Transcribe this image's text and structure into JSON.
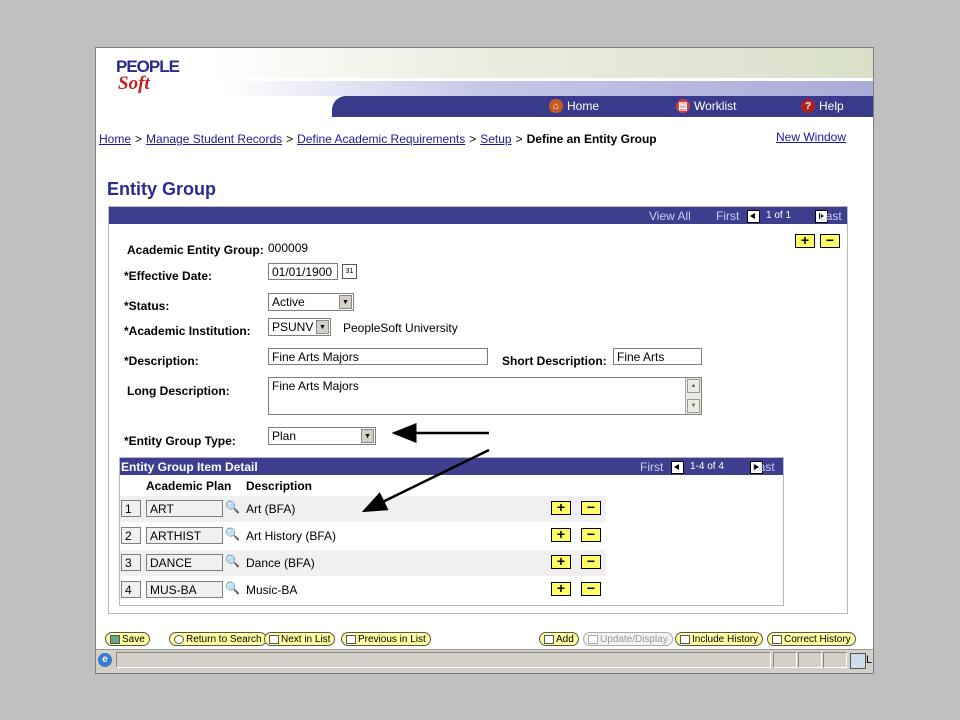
{
  "logo": {
    "line1": "PEOPLE",
    "line2": "Soft"
  },
  "nav": {
    "home": "Home",
    "worklist": "Worklist",
    "help": "Help"
  },
  "breadcrumb": {
    "items": [
      "Home",
      "Manage Student Records",
      "Define Academic Requirements",
      "Setup"
    ],
    "sep": ">",
    "current": "Define an Entity Group"
  },
  "new_window": "New Window",
  "page_title": "Entity Group",
  "panel_bar": {
    "view_all": "View All",
    "first": "First",
    "range": "1 of 1",
    "last": "Last"
  },
  "form": {
    "entity_group_label": "Academic Entity Group:",
    "entity_group_value": "000009",
    "effective_date_label": "*Effective Date:",
    "effective_date_value": "01/01/1900",
    "status_label": "*Status:",
    "status_value": "Active",
    "institution_label": "*Academic Institution:",
    "institution_value": "PSUNV",
    "institution_desc": "PeopleSoft University",
    "description_label": "*Description:",
    "description_value": "Fine Arts Majors",
    "short_desc_label": "Short Description:",
    "short_desc_value": "Fine Arts",
    "long_desc_label": "Long Description:",
    "long_desc_value": "Fine Arts Majors",
    "group_type_label": "*Entity Group Type:",
    "group_type_value": "Plan"
  },
  "detail": {
    "title": "Entity Group Item Detail",
    "first": "First",
    "range": "1-4 of 4",
    "last": "Last",
    "col_plan": "Academic Plan",
    "col_desc": "Description",
    "rows": [
      {
        "num": "1",
        "plan": "ART",
        "desc": "Art (BFA)"
      },
      {
        "num": "2",
        "plan": "ARTHIST",
        "desc": "Art History (BFA)"
      },
      {
        "num": "3",
        "plan": "DANCE",
        "desc": "Dance (BFA)"
      },
      {
        "num": "4",
        "plan": "MUS-BA",
        "desc": "Music-BA"
      }
    ]
  },
  "toolbar": {
    "save": "Save",
    "return": "Return to Search",
    "next": "Next in List",
    "prev": "Previous in List",
    "add": "Add",
    "update": "Update/Display",
    "include": "Include History",
    "correct": "Correct History"
  },
  "status_bar": {
    "zone_text": "L"
  },
  "colors": {
    "nav_bar": "#3a3a8c",
    "title": "#2a2a90",
    "link": "#1a1a9c",
    "button_yellow": "#ffff66"
  }
}
